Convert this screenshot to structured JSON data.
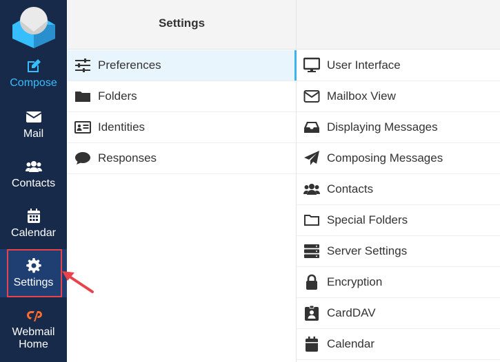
{
  "nav": {
    "items": [
      {
        "label": "Compose"
      },
      {
        "label": "Mail"
      },
      {
        "label": "Contacts"
      },
      {
        "label": "Calendar"
      },
      {
        "label": "Settings"
      },
      {
        "label": "Webmail\nHome"
      }
    ]
  },
  "settings_panel": {
    "title": "Settings",
    "items": [
      {
        "label": "Preferences",
        "icon": "sliders-icon"
      },
      {
        "label": "Folders",
        "icon": "folder-icon"
      },
      {
        "label": "Identities",
        "icon": "id-card-icon"
      },
      {
        "label": "Responses",
        "icon": "speech-bubble-icon"
      }
    ]
  },
  "preferences_panel": {
    "items": [
      {
        "label": "User Interface",
        "icon": "monitor-icon"
      },
      {
        "label": "Mailbox View",
        "icon": "envelope-icon"
      },
      {
        "label": "Displaying Messages",
        "icon": "inbox-tray-icon"
      },
      {
        "label": "Composing Messages",
        "icon": "paper-plane-icon"
      },
      {
        "label": "Contacts",
        "icon": "users-icon"
      },
      {
        "label": "Special Folders",
        "icon": "folder-outline-icon"
      },
      {
        "label": "Server Settings",
        "icon": "server-icon"
      },
      {
        "label": "Encryption",
        "icon": "lock-icon"
      },
      {
        "label": "CardDAV",
        "icon": "contact-card-icon"
      },
      {
        "label": "Calendar",
        "icon": "calendar-icon"
      }
    ]
  },
  "colors": {
    "nav_bg": "#172a4a",
    "compose_accent": "#37beff",
    "selected_row_bg": "#e9f5fd",
    "highlight_box": "#e8434b"
  }
}
